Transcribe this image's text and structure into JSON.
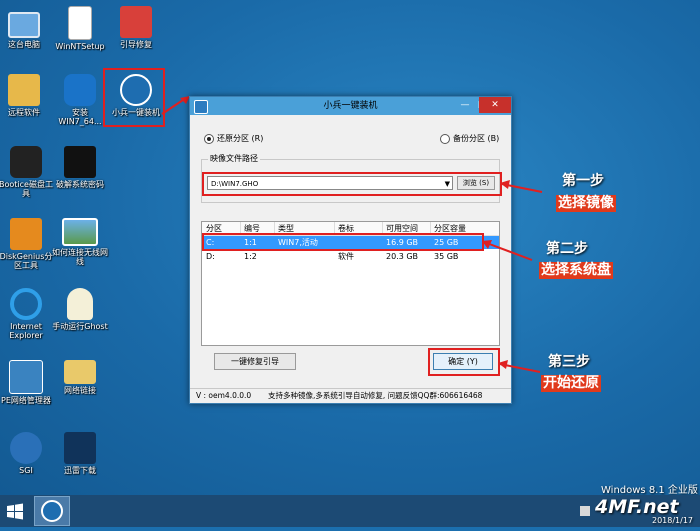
{
  "desktop": {
    "icons": [
      {
        "label": "这台电脑"
      },
      {
        "label": "WinNTSetup"
      },
      {
        "label": "引导修复"
      },
      {
        "label": "远程软件"
      },
      {
        "label": "安装WIN7_64..."
      },
      {
        "label": "小兵一键装机"
      },
      {
        "label": "Bootice磁盘工具"
      },
      {
        "label": "破解系统密码"
      },
      {
        "label": "DiskGenius分区工具"
      },
      {
        "label": "如何连接无线网线"
      },
      {
        "label": "Internet Explorer"
      },
      {
        "label": "手动运行Ghost"
      },
      {
        "label": "PE网络管理器"
      },
      {
        "label": "网络链接"
      },
      {
        "label": "SGI"
      },
      {
        "label": "迅雷下载"
      }
    ]
  },
  "window": {
    "title": "小兵一键装机",
    "radio_restore": "还原分区 (R)",
    "radio_backup": "备份分区 (B)",
    "image_path_label": "映像文件路径",
    "image_path_value": "D:\\WIN7.GHO",
    "browse_button": "浏览 (S)",
    "table": {
      "headers": [
        "分区",
        "编号",
        "类型",
        "卷标",
        "可用空间",
        "分区容量"
      ],
      "rows": [
        [
          "C:",
          "1:1",
          "WIN7,活动",
          "",
          "16.9 GB",
          "25 GB"
        ],
        [
          "D:",
          "1:2",
          "",
          "软件",
          "20.3 GB",
          "35 GB"
        ]
      ]
    },
    "repair_boot_button": "一键修复引导",
    "confirm_button": "确定 (Y)",
    "status_version": "V : oem4.0.0.0",
    "status_message": "支持多种镜像,多系统引导自动修复, 问题反馈QQ群:606616468"
  },
  "steps": [
    {
      "title": "第一步",
      "desc": "选择镜像"
    },
    {
      "title": "第二步",
      "desc": "选择系统盘"
    },
    {
      "title": "第三步",
      "desc": "开始还原"
    }
  ],
  "taskbar": {
    "os_label": "Windows 8.1 企业版",
    "date": "2018/1/17"
  },
  "watermark": "4MF.net",
  "colors": {
    "accent": "#e02020",
    "selection": "#3399ff",
    "titlebar": "#4aa0d8",
    "close": "#c7302b"
  }
}
